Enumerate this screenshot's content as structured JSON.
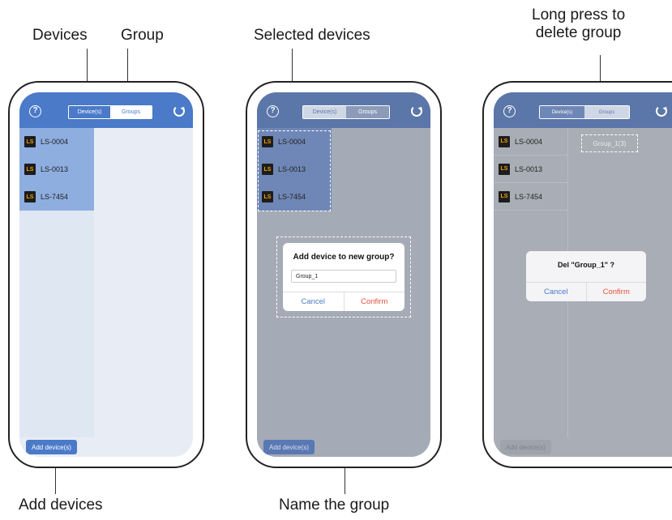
{
  "annotations": {
    "devices_tab": "Devices",
    "group_tab": "Group",
    "selected_devices": "Selected devices",
    "long_press_line1": "Long press to",
    "long_press_line2": "delete group",
    "add_devices": "Add devices",
    "name_group": "Name the group"
  },
  "app": {
    "tab_devices": "Device(s)",
    "tab_groups": "Groups",
    "devices": [
      "LS-0004",
      "LS-0013",
      "LS-7454"
    ],
    "logo_text": "LS",
    "add_button": "Add device(s)",
    "help_icon_glyph": "?"
  },
  "dialog_new_group": {
    "title": "Add device to new group?",
    "input_value": "Group_1",
    "cancel": "Cancel",
    "confirm": "Confirm"
  },
  "dialog_delete_group": {
    "group_item": "Group_1(3)",
    "title": "Del \"Group_1\" ?",
    "cancel": "Cancel",
    "confirm": "Confirm"
  },
  "colors": {
    "topbar": "#4a7ac8",
    "selected_row": "#8eaee0",
    "overlay_gray": "#a4abb6",
    "confirm_red": "#e0523b"
  }
}
